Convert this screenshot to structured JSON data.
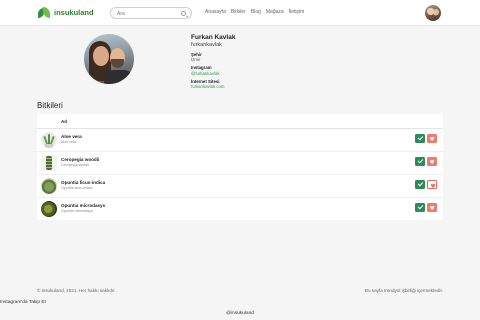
{
  "header": {
    "brand": "insukuland",
    "search_placeholder": "Ara",
    "nav": [
      "Anasayfa",
      "Bitkiler",
      "Blog",
      "Mağaza",
      "İletişim"
    ]
  },
  "profile": {
    "name": "Furkan Kavlak",
    "username": "furkankavlak",
    "city_label": "Şehir",
    "city": "İzmir",
    "instagram_label": "Instagram",
    "instagram": "@furkankavlak",
    "website_label": "İnternet Sitesi",
    "website": "furkankavlak.com"
  },
  "plants": {
    "title": "Bitkileri",
    "column_header": "Ad",
    "items": [
      {
        "name": "Aloe vera",
        "scientific": "Aloe vera",
        "favorited": true
      },
      {
        "name": "Ceropegia woodii",
        "scientific": "Ceropegia woodii",
        "favorited": true
      },
      {
        "name": "Opuntia ficus-indica",
        "scientific": "Opuntia ficus-indica",
        "favorited": false
      },
      {
        "name": "Opuntia microdasys",
        "scientific": "Opuntia microdasys",
        "favorited": true
      }
    ]
  },
  "footer": {
    "copyright": "© insukuland, 2021. Her hakkı saklıdır.",
    "note": "Bu sayfa trendyol işbirliği içermektedir.",
    "instagram_follow": "Instagram'da Takip Et",
    "instagram_handle": "@insukuland"
  },
  "colors": {
    "brand": "#2e7d32",
    "accent_green": "#2e8b57",
    "accent_red": "#f07a6e",
    "link": "#2e9b5a"
  }
}
